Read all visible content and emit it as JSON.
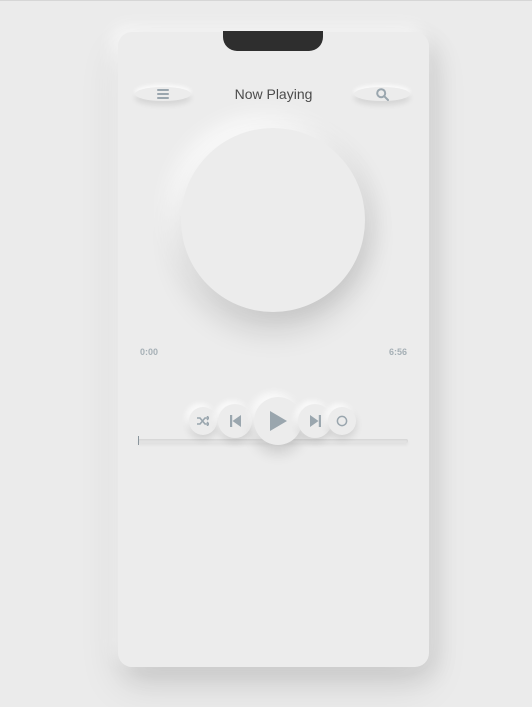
{
  "header": {
    "title": "Now Playing"
  },
  "icons": {
    "menu": "menu-icon",
    "search": "search-icon",
    "shuffle": "shuffle-icon",
    "previous": "skip-previous-icon",
    "play": "play-icon",
    "next": "skip-next-icon",
    "repeat": "repeat-icon"
  },
  "player": {
    "current_time": "0:00",
    "duration": "6:56",
    "progress_fraction": 0
  },
  "colors": {
    "background": "#ebebeb",
    "surface": "#ececec",
    "accent": "#9aa6ae",
    "notch": "#2e2e2e",
    "title": "#4a4a4a"
  }
}
